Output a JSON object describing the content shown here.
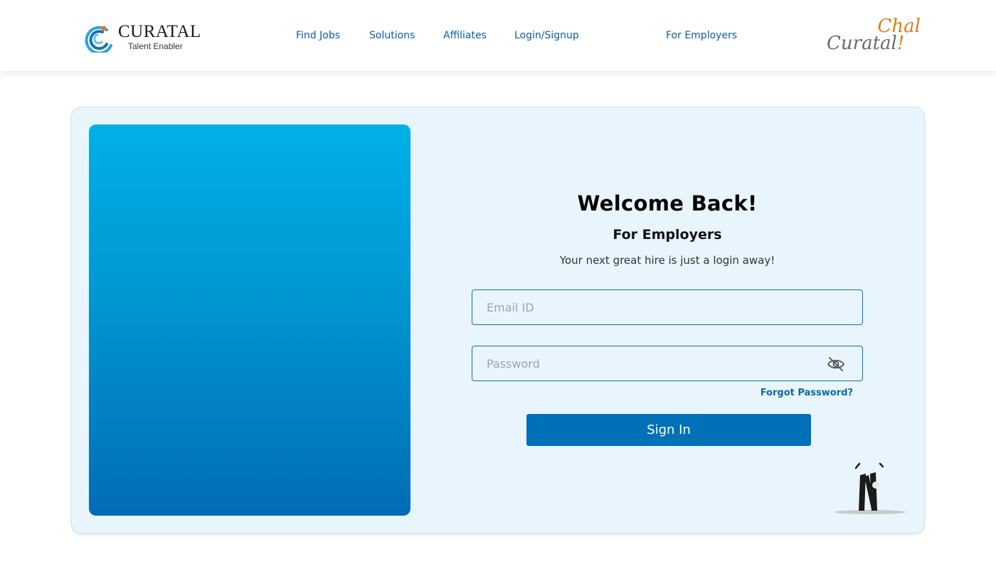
{
  "header": {
    "logo": {
      "name": "CURATAL",
      "tagline": "Talent Enabler"
    },
    "nav": [
      {
        "label": "Find Jobs"
      },
      {
        "label": "Solutions"
      },
      {
        "label": "Affiliates"
      },
      {
        "label": "Login/Signup"
      },
      {
        "label": "For Employers"
      }
    ],
    "brand_script": {
      "line1": "Chal",
      "line2": "Curatal",
      "excl": "!"
    }
  },
  "login": {
    "title": "Welcome Back!",
    "subtitle": "For Employers",
    "tagline": "Your next great hire is just a login away!",
    "email": {
      "placeholder": "Email ID",
      "value": ""
    },
    "password": {
      "placeholder": "Password",
      "value": ""
    },
    "forgot_label": "Forgot Password?",
    "signin_label": "Sign In"
  },
  "icons": [
    "curatal-logo-icon",
    "eye-off-icon",
    "person-illustration"
  ],
  "colors": {
    "primary": "#0071b9",
    "nav_text": "#0b5d9e",
    "card_bg": "#e8f5fd",
    "gradient_top": "#01b0e8",
    "gradient_bottom": "#016cb5",
    "accent_orange": "#e07a1b"
  }
}
